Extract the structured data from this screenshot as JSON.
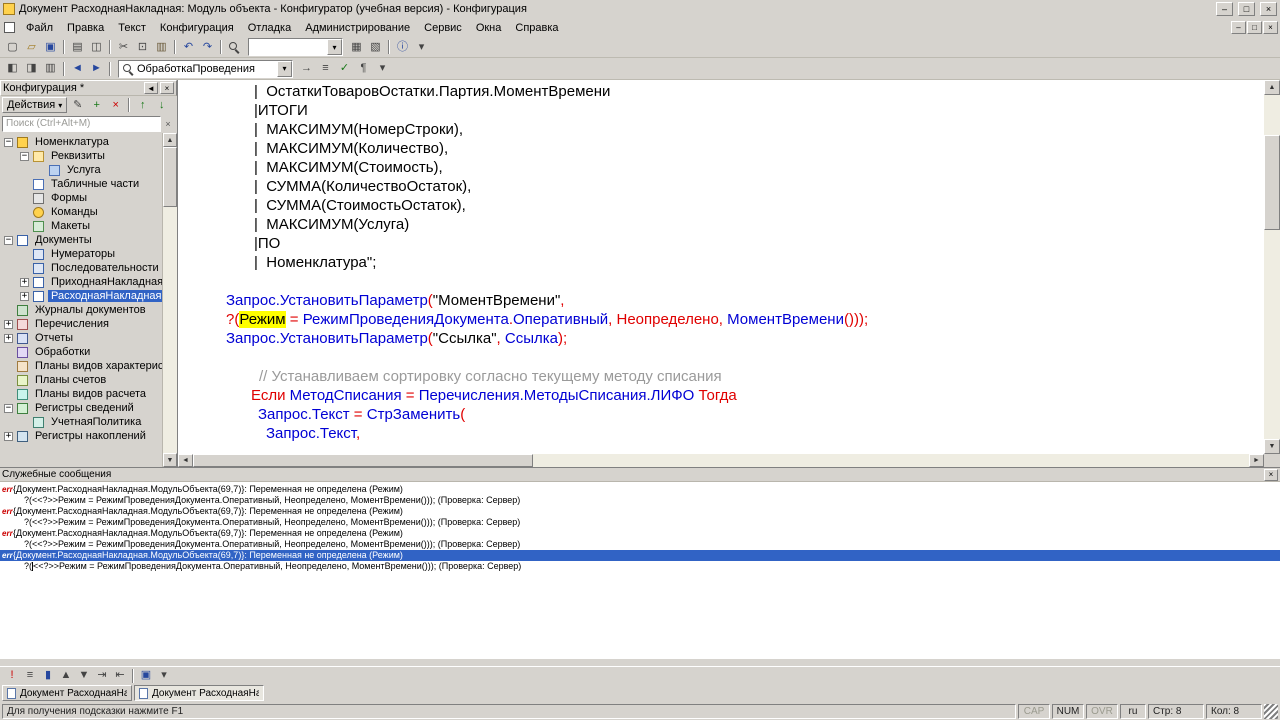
{
  "window": {
    "title": "Документ РасходнаяНакладная: Модуль объекта - Конфигуратор (учебная версия) - Конфигурация"
  },
  "icons": {
    "minimize": "–",
    "restore": "❐",
    "maximize": "□",
    "close": "×",
    "dropdown": "▾",
    "up_arrow": "▲",
    "down_arrow": "▼",
    "left_arrow": "◄",
    "right_arrow": "►",
    "clear": "×",
    "pin": "◄"
  },
  "menu": {
    "items": [
      "Файл",
      "Правка",
      "Текст",
      "Конфигурация",
      "Отладка",
      "Администрирование",
      "Сервис",
      "Окна",
      "Справка"
    ]
  },
  "toolbar_main": {
    "combo_value": "",
    "buttons_left": [
      {
        "name": "new-document",
        "g": "▢",
        "c": "#444444"
      },
      {
        "name": "open-file",
        "g": "▱",
        "c": "#a07a1e"
      },
      {
        "name": "save",
        "g": "▣",
        "c": "#26479e"
      },
      {
        "sep": true
      },
      {
        "name": "print",
        "g": "▤",
        "c": "#444444"
      },
      {
        "name": "print-preview",
        "g": "◫",
        "c": "#444444"
      },
      {
        "sep": true
      },
      {
        "name": "cut",
        "g": "✂",
        "c": "#444444"
      },
      {
        "name": "copy",
        "g": "⊡",
        "c": "#444444"
      },
      {
        "name": "paste",
        "g": "▥",
        "c": "#6a5a3a"
      },
      {
        "sep": true
      },
      {
        "name": "undo",
        "g": "↶",
        "c": "#26479e"
      },
      {
        "name": "redo",
        "g": "↷",
        "c": "#26479e"
      },
      {
        "sep": true
      },
      {
        "name": "find",
        "g": "MAG"
      }
    ],
    "buttons_right": [
      {
        "name": "calculator",
        "g": "▦",
        "c": "#444444"
      },
      {
        "name": "calendar",
        "g": "▧",
        "c": "#444444"
      },
      {
        "sep": true
      },
      {
        "name": "help-info",
        "g": "ⓘ",
        "c": "#26479e"
      },
      {
        "name": "toolbar-options",
        "g": "▾",
        "c": "#444444"
      }
    ]
  },
  "toolbar_module": {
    "combo_value": "ОбработкаПроведения",
    "buttons_left": [
      {
        "name": "toggle-config-window",
        "g": "◧",
        "c": "#444444"
      },
      {
        "name": "toggle-properties-window",
        "g": "◨",
        "c": "#444444"
      },
      {
        "name": "toggle-messages-window",
        "g": "▥",
        "c": "#444444"
      },
      {
        "sep": true
      },
      {
        "name": "navigate-back",
        "g": "◄",
        "c": "#26479e"
      },
      {
        "name": "navigate-forward",
        "g": "►",
        "c": "#26479e"
      },
      {
        "sep": true
      }
    ],
    "buttons_right": [
      {
        "name": "go-to-line",
        "g": "→",
        "c": "#444444"
      },
      {
        "name": "procedures-list",
        "g": "≡",
        "c": "#444444"
      },
      {
        "name": "syntax-check",
        "g": "✓",
        "c": "#187818"
      },
      {
        "name": "format-block",
        "g": "¶",
        "c": "#444444"
      },
      {
        "name": "module-toolbar-options",
        "g": "▾",
        "c": "#444444"
      }
    ]
  },
  "config_panel": {
    "title": "Конфигурация *",
    "actions_label": "Действия",
    "search_placeholder": "Поиск (Ctrl+Alt+М)",
    "actions_buttons": [
      {
        "name": "edit-object",
        "g": "✎",
        "c": "#444444"
      },
      {
        "name": "add-object",
        "g": "+",
        "c": "#187818"
      },
      {
        "name": "delete-object",
        "g": "×",
        "c": "#cc0000"
      },
      {
        "sep": true
      },
      {
        "name": "move-up",
        "g": "↑",
        "c": "#187818"
      },
      {
        "name": "move-down",
        "g": "↓",
        "c": "#187818"
      }
    ],
    "tree": [
      {
        "id": "nomenklatura",
        "label": "Номенклатура",
        "level": 0,
        "exp": "minus",
        "icon": "catalog"
      },
      {
        "id": "rekvizity",
        "label": "Реквизиты",
        "level": 1,
        "exp": "minus",
        "icon": "folder"
      },
      {
        "id": "usluga",
        "label": "Услуга",
        "level": 2,
        "icon": "attribute"
      },
      {
        "id": "tablichnye-chasti",
        "label": "Табличные части",
        "level": 1,
        "icon": "tabular"
      },
      {
        "id": "formy",
        "label": "Формы",
        "level": 1,
        "icon": "form"
      },
      {
        "id": "komandy",
        "label": "Команды",
        "level": 1,
        "icon": "command"
      },
      {
        "id": "makety",
        "label": "Макеты",
        "level": 1,
        "icon": "layout"
      },
      {
        "id": "dokumenty",
        "label": "Документы",
        "level": 0,
        "exp": "minus",
        "icon": "documents"
      },
      {
        "id": "numeratory",
        "label": "Нумераторы",
        "level": 1,
        "icon": "numerator"
      },
      {
        "id": "posledovatelnosti",
        "label": "Последовательности",
        "level": 1,
        "icon": "sequence"
      },
      {
        "id": "prihodnaya-nakladnaya",
        "label": "ПриходнаяНакладная",
        "level": 1,
        "exp": "plus",
        "icon": "document"
      },
      {
        "id": "rashodnaya-nakladnaya",
        "label": "РасходнаяНакладная",
        "level": 1,
        "exp": "plus",
        "icon": "document",
        "selected": true
      },
      {
        "id": "zhurnaly-dokumentov",
        "label": "Журналы документов",
        "level": 0,
        "icon": "journal"
      },
      {
        "id": "perechisleniya",
        "label": "Перечисления",
        "level": 0,
        "exp": "plus",
        "icon": "enum"
      },
      {
        "id": "otchety",
        "label": "Отчеты",
        "level": 0,
        "exp": "plus",
        "icon": "report"
      },
      {
        "id": "obrabotki",
        "label": "Обработки",
        "level": 0,
        "icon": "dataprocessor"
      },
      {
        "id": "plany-vidov-harakteristik",
        "label": "Планы видов характеристик",
        "level": 0,
        "icon": "chartct"
      },
      {
        "id": "plany-schetov",
        "label": "Планы счетов",
        "level": 0,
        "icon": "chartacc"
      },
      {
        "id": "plany-vidov-rascheta",
        "label": "Планы видов расчета",
        "level": 0,
        "icon": "chartcalc"
      },
      {
        "id": "registry-svedeniy",
        "label": "Регистры сведений",
        "level": 0,
        "exp": "minus",
        "icon": "inforegfolder"
      },
      {
        "id": "uchetnaya-politika",
        "label": "УчетнаяПолитика",
        "level": 1,
        "icon": "inforeg"
      },
      {
        "id": "registry-nakopleniy",
        "label": "Регистры накоплений",
        "level": 0,
        "exp": "plus",
        "icon": "accumreg"
      }
    ]
  },
  "editor": {
    "lines": [
      {
        "ind": 76,
        "seg": [
          [
            "s",
            "|  ОстаткиТоваровОстатки.Партия.МоментВремени"
          ]
        ]
      },
      {
        "ind": 76,
        "seg": [
          [
            "s",
            "|ИТОГИ"
          ]
        ]
      },
      {
        "ind": 76,
        "seg": [
          [
            "s",
            "|  МАКСИМУМ(НомерСтроки),"
          ]
        ]
      },
      {
        "ind": 76,
        "seg": [
          [
            "s",
            "|  МАКСИМУМ(Количество),"
          ]
        ]
      },
      {
        "ind": 76,
        "seg": [
          [
            "s",
            "|  МАКСИМУМ(Стоимость),"
          ]
        ]
      },
      {
        "ind": 76,
        "seg": [
          [
            "s",
            "|  СУММА(КоличествоОстаток),"
          ]
        ]
      },
      {
        "ind": 76,
        "seg": [
          [
            "s",
            "|  СУММА(СтоимостьОстаток),"
          ]
        ]
      },
      {
        "ind": 76,
        "seg": [
          [
            "s",
            "|  МАКСИМУМ(Услуга)"
          ]
        ]
      },
      {
        "ind": 76,
        "seg": [
          [
            "s",
            "|ПО"
          ]
        ]
      },
      {
        "ind": 76,
        "seg": [
          [
            "s",
            "|  Номенклатура\";"
          ]
        ]
      },
      {
        "ind": 0,
        "seg": []
      },
      {
        "ind": 48,
        "seg": [
          [
            "i",
            "Запрос.УстановитьПараметр"
          ],
          [
            "k",
            "("
          ],
          [
            "s",
            "\"МоментВремени\""
          ],
          [
            "k",
            ","
          ]
        ]
      },
      {
        "ind": 48,
        "seg": [
          [
            "k",
            "?("
          ],
          [
            "hl",
            "Режим"
          ],
          [
            "k",
            " = "
          ],
          [
            "i",
            "РежимПроведенияДокумента"
          ],
          [
            "k",
            "."
          ],
          [
            "i",
            "Оперативный"
          ],
          [
            "k",
            ", Неопределено, "
          ],
          [
            "i",
            "МоментВремени"
          ],
          [
            "k",
            "()));"
          ]
        ]
      },
      {
        "ind": 48,
        "seg": [
          [
            "i",
            "Запрос.УстановитьПараметр"
          ],
          [
            "k",
            "("
          ],
          [
            "s",
            "\"Ссылка\""
          ],
          [
            "k",
            ", "
          ],
          [
            "i",
            "Ссылка"
          ],
          [
            "k",
            ");"
          ]
        ]
      },
      {
        "ind": 0,
        "seg": []
      },
      {
        "ind": 81,
        "seg": [
          [
            "c",
            "// Устанавливаем сортировку согласно текущему методу списания"
          ]
        ]
      },
      {
        "ind": 73,
        "seg": [
          [
            "k",
            "Если "
          ],
          [
            "i",
            "МетодСписания"
          ],
          [
            "k",
            " = "
          ],
          [
            "i",
            "Перечисления.МетодыСписания.ЛИФО"
          ],
          [
            "k",
            " Тогда"
          ]
        ]
      },
      {
        "ind": 80,
        "seg": [
          [
            "i",
            "Запрос.Текст"
          ],
          [
            "k",
            " = "
          ],
          [
            "i",
            "СтрЗаменить"
          ],
          [
            "k",
            "("
          ]
        ]
      },
      {
        "ind": 88,
        "seg": [
          [
            "i",
            "Запрос.Текст"
          ],
          [
            "k",
            ","
          ]
        ]
      }
    ]
  },
  "messages": {
    "title": "Служебные сообщения",
    "error_marker": "err",
    "rows": [
      {
        "type": "error",
        "text": "{Документ.РасходнаяНакладная.МодульОбъекта(69,7)}: Переменная не определена (Режим)"
      },
      {
        "type": "detail",
        "text": "?(<<?>>Режим = РежимПроведенияДокумента.Оперативный, Неопределено, МоментВремени())); (Проверка: Сервер)"
      },
      {
        "type": "error",
        "text": "{Документ.РасходнаяНакладная.МодульОбъекта(69,7)}: Переменная не определена (Режим)"
      },
      {
        "type": "detail",
        "text": "?(<<?>>Режим = РежимПроведенияДокумента.Оперативный, Неопределено, МоментВремени())); (Проверка: Сервер)"
      },
      {
        "type": "error",
        "text": "{Документ.РасходнаяНакладная.МодульОбъекта(69,7)}: Переменная не определена (Режим)"
      },
      {
        "type": "detail",
        "text": "?(<<?>>Режим = РежимПроведенияДокумента.Оперативный, Неопределено, МоментВремени())); (Проверка: Сервер)"
      },
      {
        "type": "error",
        "selected": true,
        "text": "{Документ.РасходнаяНакладная.МодульОбъекта(69,7)}: Переменная не определена (Режим)"
      },
      {
        "type": "detail",
        "pre": "?(",
        "text": "<<?>>Режим = РежимПроведенияДокумента.Оперативный, Неопределено, МоментВремени())); (Проверка: Сервер)"
      }
    ]
  },
  "bottom_toolbar": {
    "buttons": [
      {
        "name": "next-error",
        "g": "!",
        "c": "#cc0000"
      },
      {
        "name": "procedures-functions",
        "g": "≡",
        "c": "#444444"
      },
      {
        "name": "toggle-bookmark",
        "g": "▮",
        "c": "#26479e"
      },
      {
        "name": "previous-bookmark",
        "g": "▲",
        "c": "#444444"
      },
      {
        "name": "next-bookmark",
        "g": "▼",
        "c": "#444444"
      },
      {
        "name": "increase-indent",
        "g": "⇥",
        "c": "#444444"
      },
      {
        "name": "decrease-indent",
        "g": "⇤",
        "c": "#444444"
      },
      {
        "sep": true
      },
      {
        "name": "save-module",
        "g": "▣",
        "c": "#26479e"
      },
      {
        "name": "bottom-toolbar-options",
        "g": "▾",
        "c": "#444444"
      }
    ]
  },
  "tabs": [
    {
      "label": "Документ РасходнаяНакла...",
      "active": false
    },
    {
      "label": "Документ РасходнаяНакла...",
      "active": true
    }
  ],
  "status_bar": {
    "hint": "Для получения подсказки нажмите F1",
    "indicators": [
      {
        "label": "CAP",
        "enabled": false
      },
      {
        "label": "NUM",
        "enabled": true
      },
      {
        "label": "OVR",
        "enabled": false
      }
    ],
    "lang": "ru",
    "line_label": "Стр: 8",
    "col_label": "Кол: 8"
  }
}
